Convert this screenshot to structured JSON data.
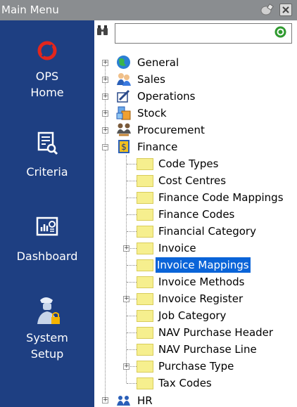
{
  "window": {
    "title": "Main Menu"
  },
  "sidebar": {
    "items": [
      {
        "label_lines": [
          "OPS",
          "Home"
        ],
        "icon": "ops-logo-icon"
      },
      {
        "label_lines": [
          "Criteria"
        ],
        "icon": "criteria-icon"
      },
      {
        "label_lines": [
          "Dashboard"
        ],
        "icon": "dashboard-icon"
      },
      {
        "label_lines": [
          "System",
          "Setup"
        ],
        "icon": "system-setup-icon"
      }
    ]
  },
  "search": {
    "value": "",
    "placeholder": ""
  },
  "tree": {
    "top": [
      {
        "label": "General",
        "icon": "globe-icon",
        "expanded": false
      },
      {
        "label": "Sales",
        "icon": "sales-people-icon",
        "expanded": false
      },
      {
        "label": "Operations",
        "icon": "operations-icon",
        "expanded": false
      },
      {
        "label": "Stock",
        "icon": "stock-icon",
        "expanded": false
      },
      {
        "label": "Procurement",
        "icon": "procurement-icon",
        "expanded": false
      },
      {
        "label": "Finance",
        "icon": "finance-icon",
        "expanded": true
      }
    ],
    "finance_children": [
      {
        "label": "Code Types",
        "expandable": false,
        "selected": false
      },
      {
        "label": "Cost Centres",
        "expandable": false,
        "selected": false
      },
      {
        "label": "Finance Code Mappings",
        "expandable": false,
        "selected": false
      },
      {
        "label": "Finance Codes",
        "expandable": false,
        "selected": false
      },
      {
        "label": "Financial Category",
        "expandable": false,
        "selected": false
      },
      {
        "label": "Invoice",
        "expandable": true,
        "selected": false
      },
      {
        "label": "Invoice Mappings",
        "expandable": false,
        "selected": true
      },
      {
        "label": "Invoice Methods",
        "expandable": false,
        "selected": false
      },
      {
        "label": "Invoice Register",
        "expandable": true,
        "selected": false
      },
      {
        "label": "Job Category",
        "expandable": false,
        "selected": false
      },
      {
        "label": "NAV Purchase Header",
        "expandable": false,
        "selected": false
      },
      {
        "label": "NAV Purchase Line",
        "expandable": false,
        "selected": false
      },
      {
        "label": "Purchase Type",
        "expandable": true,
        "selected": false
      },
      {
        "label": "Tax Codes",
        "expandable": false,
        "selected": false
      }
    ],
    "bottom": [
      {
        "label": "HR",
        "icon": "hr-people-icon",
        "expanded": false
      }
    ]
  },
  "colors": {
    "sidebar_bg": "#1e3f82",
    "titlebar_bg": "#8a8d90",
    "selection": "#0a64d8",
    "folder": "#f6ef8e"
  }
}
